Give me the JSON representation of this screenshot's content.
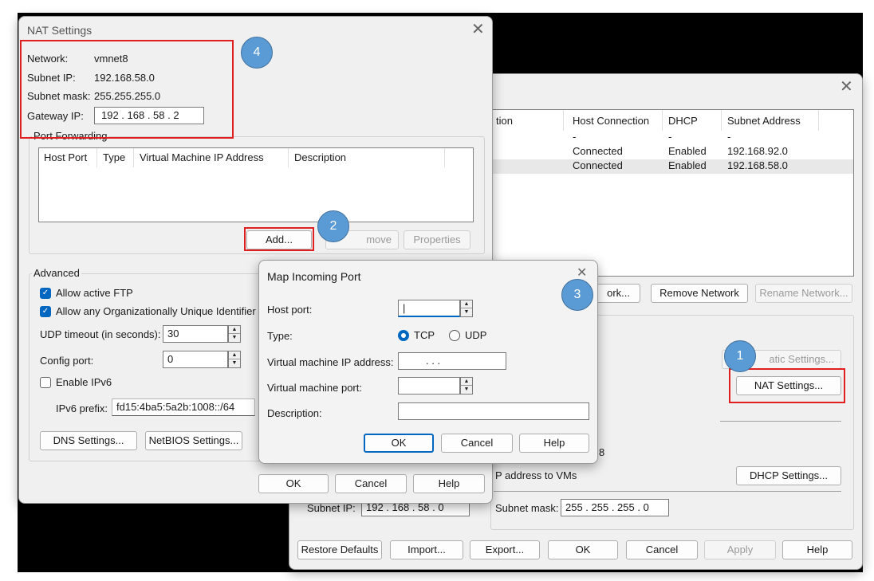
{
  "vne": {
    "header": {
      "col_name_fragment": "tion",
      "host_connection": "Host Connection",
      "dhcp": "DHCP",
      "subnet_address": "Subnet Address"
    },
    "rows": [
      {
        "host_connection": "-",
        "dhcp": "-",
        "subnet": "-"
      },
      {
        "host_connection": "Connected",
        "dhcp": "Enabled",
        "subnet": "192.168.92.0"
      },
      {
        "host_connection": "Connected",
        "dhcp": "Enabled",
        "subnet": "192.168.58.0"
      }
    ],
    "add_network_fragment": "ork...",
    "remove_network": "Remove Network",
    "rename_network": "Rename Network...",
    "automatic_settings_fragment": "atic Settings...",
    "nat_settings": "NAT Settings...",
    "number_fragment": "8",
    "dhcp_label_fragment": "P address to VMs",
    "dhcp_settings": "DHCP Settings...",
    "subnet_ip_label": "Subnet IP:",
    "subnet_ip_value": "192 . 168 . 58 . 0",
    "subnet_mask_label": "Subnet mask:",
    "subnet_mask_value": "255 . 255 . 255 . 0",
    "restore_defaults": "Restore Defaults",
    "import": "Import...",
    "export": "Export...",
    "ok": "OK",
    "cancel": "Cancel",
    "apply": "Apply",
    "help": "Help"
  },
  "nat": {
    "title": "NAT Settings",
    "network_label": "Network:",
    "network_value": "vmnet8",
    "subnet_ip_label": "Subnet IP:",
    "subnet_ip_value": "192.168.58.0",
    "subnet_mask_label": "Subnet mask:",
    "subnet_mask_value": "255.255.255.0",
    "gateway_label": "Gateway IP:",
    "gateway_value": "192 . 168 . 58 . 2",
    "port_forwarding": "Port Forwarding",
    "columns": {
      "host_port": "Host Port",
      "type": "Type",
      "vm_ip": "Virtual Machine IP Address",
      "description": "Description"
    },
    "add": "Add...",
    "remove_fragment": "move",
    "properties": "Properties",
    "advanced": "Advanced",
    "allow_ftp": "Allow active FTP",
    "allow_oui": "Allow any Organizationally Unique Identifier",
    "udp_timeout_label": "UDP timeout (in seconds):",
    "udp_timeout_value": "30",
    "config_port_label": "Config port:",
    "config_port_value": "0",
    "enable_ipv6": "Enable IPv6",
    "ipv6_prefix_label": "IPv6 prefix:",
    "ipv6_prefix_value": "fd15:4ba5:5a2b:1008::/64",
    "dns_settings": "DNS Settings...",
    "netbios_settings": "NetBIOS Settings...",
    "ok": "OK",
    "cancel": "Cancel",
    "help": "Help"
  },
  "map": {
    "title": "Map Incoming Port",
    "host_port_label": "Host port:",
    "host_port_value": "|",
    "type_label": "Type:",
    "tcp": "TCP",
    "udp": "UDP",
    "vm_ip_label": "Virtual machine IP address:",
    "vm_ip_value": ".          .          .",
    "vm_port_label": "Virtual machine port:",
    "description_label": "Description:",
    "ok": "OK",
    "cancel": "Cancel",
    "help": "Help"
  },
  "badges": [
    "1",
    "2",
    "3",
    "4"
  ],
  "colors": {
    "accent": "#0067c0",
    "highlight": "#e02020",
    "badge": "#5b9bd5"
  }
}
